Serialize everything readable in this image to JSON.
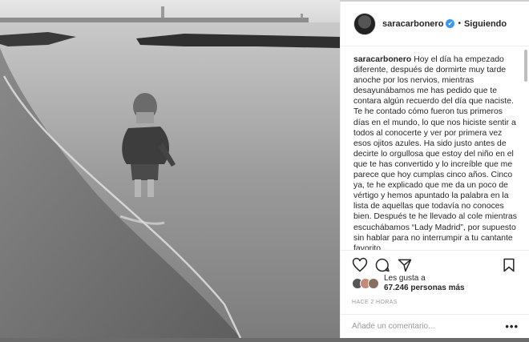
{
  "post": {
    "username": "saracarbonero",
    "follow_status": "Siguiendo",
    "separator": "•",
    "verified_glyph": "✔",
    "caption_user": "saracarbonero",
    "caption_text": "Hoy el día ha empezado diferente, después de dormirte muy tarde anoche por los nervios, mientras desayunábamos me has pedido que te contara algún recuerdo del día que naciste. Te he contado cómo fueron tus primeros días en el mundo, lo que nos hiciste sentir a todos al conocerte y ver por primera vez esos ojitos azules. Ha sido justo antes de decirte lo orgullosa que estoy del niño en el que te has convertido y lo increíble que me parece que hoy cumplas cinco años. Cinco ya, te he explicado que me da un poco de vértigo y hemos apuntado la palabra en la lista de aquellas que todavía no conoces bien. Después te he llevado al cole mientras escuchábamos “Lady Madrid”, por supuesto sin hablar para no interrumpir a tu cantante favorito...",
    "likes_prefix": "Les gusta a",
    "likes_count": "67.246 personas más",
    "time_ago": "HACE 2 HORAS",
    "comment_placeholder": "Añade un comentario...",
    "more_options": "•••"
  },
  "icons": {
    "like": "heart-icon",
    "comment": "comment-icon",
    "share": "share-icon",
    "save": "bookmark-icon"
  },
  "colors": {
    "verified": "#3897f0",
    "text": "#262626",
    "muted": "#999999"
  }
}
